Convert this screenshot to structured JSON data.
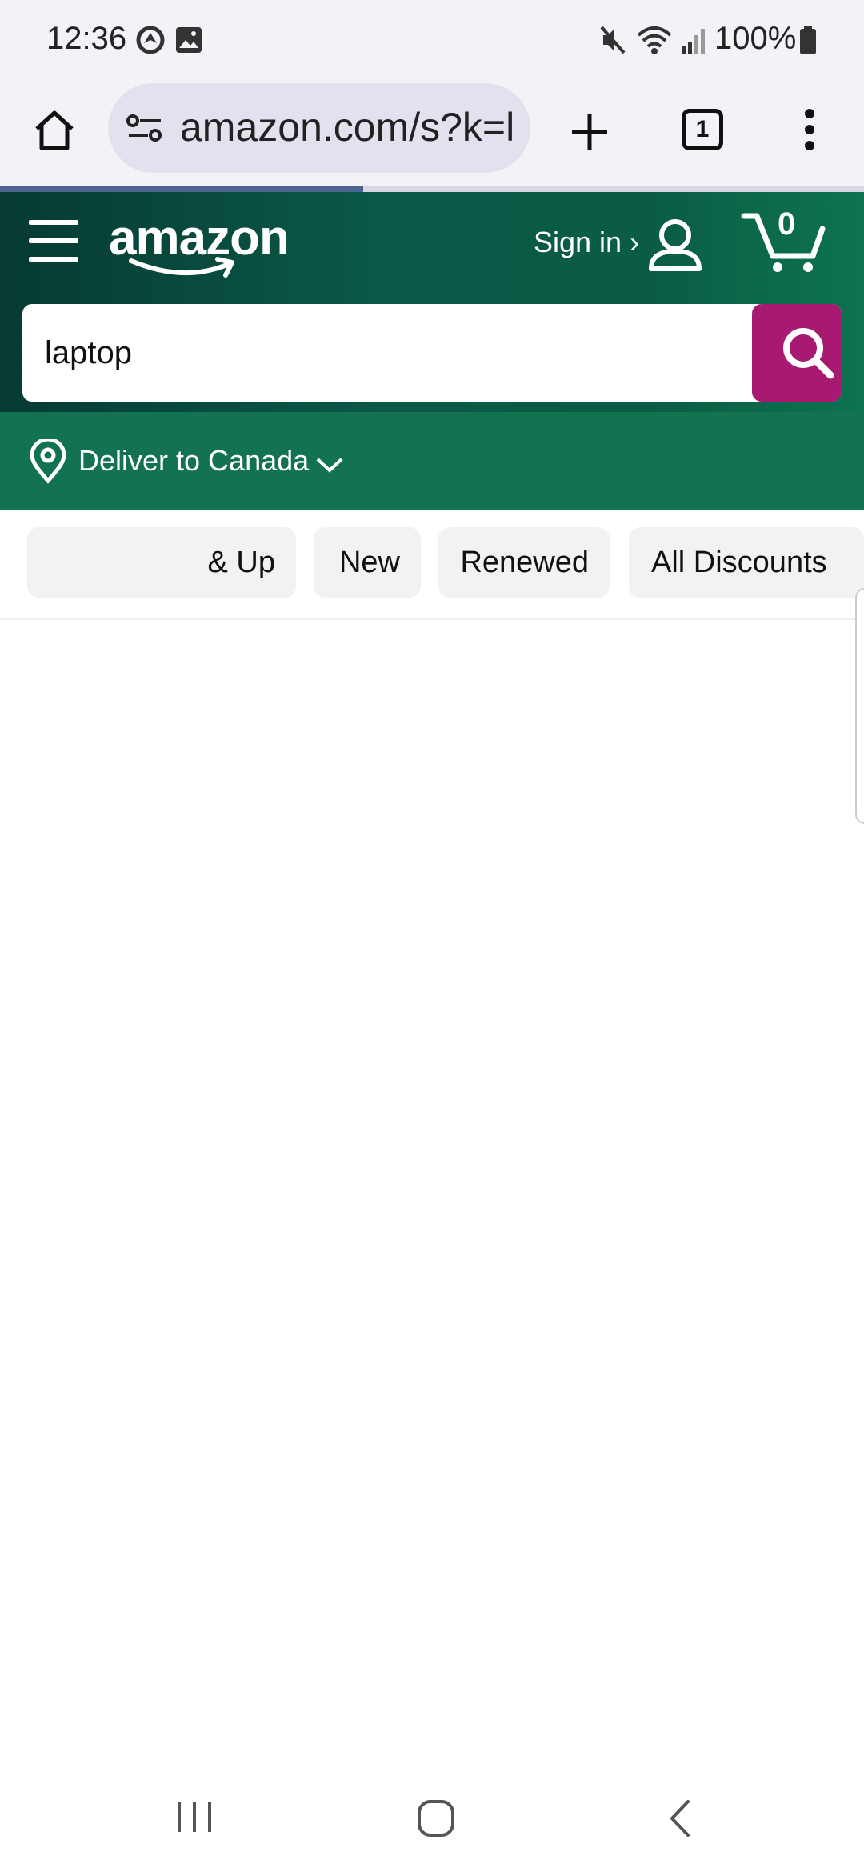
{
  "status_bar": {
    "time": "12:36",
    "battery": "100%",
    "icons": [
      "vpn-icon",
      "gallery-icon",
      "mute-icon",
      "wifi-icon",
      "signal-icon",
      "battery-icon"
    ]
  },
  "browser": {
    "url": "amazon.com/s?k=l",
    "tab_count": "1",
    "load_progress": 0.42
  },
  "header": {
    "logo_text": "amazon",
    "sign_in_label": "Sign in ›",
    "cart_count": "0"
  },
  "search": {
    "value": "laptop"
  },
  "delivery": {
    "label": "Deliver to Canada"
  },
  "filters": {
    "chips": [
      "& Up",
      "New",
      "Renewed",
      "All Discounts"
    ]
  },
  "colors": {
    "header_green": "#0a5c45",
    "deliver_green": "#137351",
    "search_button": "#a81a72"
  }
}
